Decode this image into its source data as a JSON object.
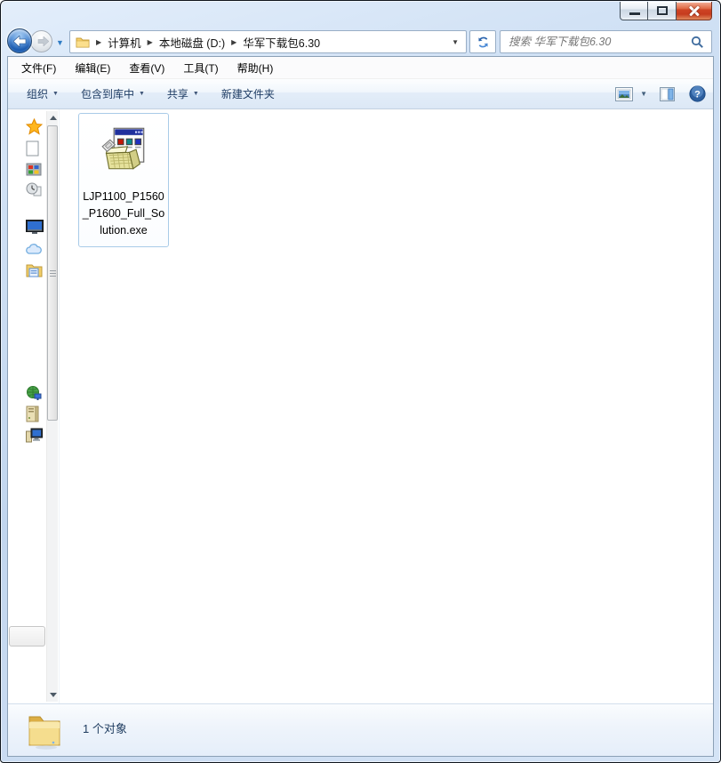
{
  "window": {
    "title": "",
    "controls": [
      "minimize-button",
      "maximize-button",
      "close-button"
    ]
  },
  "navigation": {
    "breadcrumb": [
      "计算机",
      "本地磁盘 (D:)",
      "华军下载包6.30"
    ],
    "search": {
      "placeholder": "搜索 华军下载包6.30"
    }
  },
  "menubar": {
    "items": [
      "文件(F)",
      "编辑(E)",
      "查看(V)",
      "工具(T)",
      "帮助(H)"
    ]
  },
  "toolbar": {
    "items": [
      {
        "label": "组织",
        "dropdown": true
      },
      {
        "label": "包含到库中",
        "dropdown": true
      },
      {
        "label": "共享",
        "dropdown": true
      },
      {
        "label": "新建文件夹",
        "dropdown": false
      }
    ],
    "right_icons": [
      "views-icon",
      "views-dropdown-caret",
      "preview-pane-icon",
      "help-icon"
    ]
  },
  "sidebar": {
    "icons": [
      "favorites-star-icon",
      "page-icon",
      "libraries-icon",
      "recent-places-icon",
      "desktop-icon",
      "cloud-icon",
      "documents-folder-icon",
      "network-icon",
      "drive-tower-icon",
      "computer-icon"
    ]
  },
  "content": {
    "files": [
      {
        "name": "LJP1100_P1560_P1600_Full_Solution.exe",
        "selected": true,
        "icon": "installer-exe-icon"
      }
    ]
  },
  "statusbar": {
    "item_count_text": "1 个对象"
  },
  "colors": {
    "glass": "#c9dcf2",
    "toolbar_text": "#1e3c64",
    "selection_border": "#a9cbe8",
    "close_button_red": "#ce4324",
    "accent_blue": "#2a64ad"
  }
}
